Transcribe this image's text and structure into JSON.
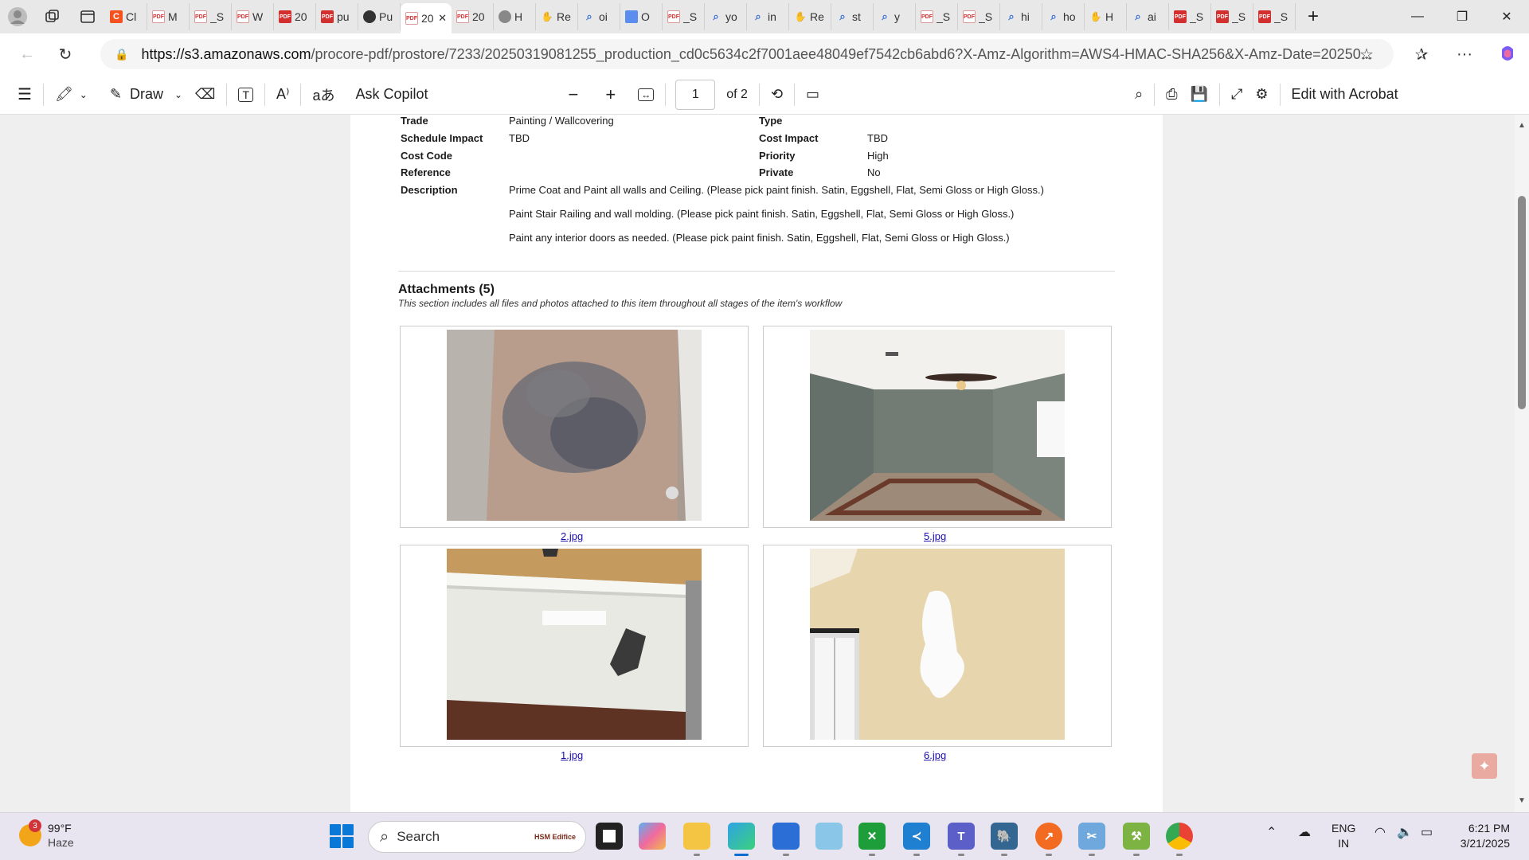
{
  "browser": {
    "tabs": [
      {
        "icon": "orange-c-favicon",
        "title": "Cl"
      },
      {
        "icon": "pdf-light-favicon",
        "title": "M"
      },
      {
        "icon": "pdf-light-favicon",
        "title": "_S"
      },
      {
        "icon": "pdf-light-favicon",
        "title": "W"
      },
      {
        "icon": "pdf-favicon",
        "title": "20"
      },
      {
        "icon": "pdf-favicon",
        "title": "pu"
      },
      {
        "icon": "black-circle-favicon",
        "title": "Pu"
      },
      {
        "icon": "pdf-light-favicon",
        "title": "20",
        "active": true
      },
      {
        "icon": "pdf-light-favicon",
        "title": "20"
      },
      {
        "icon": "gray-circle-favicon",
        "title": "H"
      },
      {
        "icon": "hand-favicon",
        "title": "Re"
      },
      {
        "icon": "search-favicon",
        "title": "oi"
      },
      {
        "icon": "doc-favicon",
        "title": "O"
      },
      {
        "icon": "pdf-light-favicon",
        "title": "_S"
      },
      {
        "icon": "search-favicon",
        "title": "yo"
      },
      {
        "icon": "search-favicon",
        "title": "in"
      },
      {
        "icon": "hand-favicon",
        "title": "Re"
      },
      {
        "icon": "search-favicon",
        "title": "st"
      },
      {
        "icon": "search-favicon",
        "title": "y"
      },
      {
        "icon": "pdf-light-favicon",
        "title": "_S"
      },
      {
        "icon": "pdf-light-favicon",
        "title": "_S"
      },
      {
        "icon": "search-favicon",
        "title": "hi"
      },
      {
        "icon": "search-favicon",
        "title": "ho"
      },
      {
        "icon": "hand-favicon",
        "title": "H"
      },
      {
        "icon": "search-favicon",
        "title": "ai"
      },
      {
        "icon": "pdf-favicon",
        "title": "_S"
      },
      {
        "icon": "pdf-favicon",
        "title": "_S"
      },
      {
        "icon": "pdf-favicon",
        "title": "_S"
      }
    ],
    "url_host": "https://s3.amazonaws.com",
    "url_path": "/procore-pdf/prostore/7233/20250319081255_production_cd0c5634c2f7001aee48049ef7542cb6abd6?X-Amz-Algorithm=AWS4-HMAC-SHA256&X-Amz-Date=20250..."
  },
  "pdf_toolbar": {
    "draw_label": "Draw",
    "ask_copilot_label": "Ask Copilot",
    "page_current": "1",
    "page_total": "of 2",
    "edit_acrobat_label": "Edit with Acrobat"
  },
  "document": {
    "fields_left": [
      {
        "label": "Trade",
        "value": "Painting / Wallcovering"
      },
      {
        "label": "Schedule Impact",
        "value": "TBD"
      },
      {
        "label": "Cost Code",
        "value": ""
      },
      {
        "label": "Reference",
        "value": ""
      },
      {
        "label": "Description",
        "value": "Prime Coat and Paint all walls and Ceiling. (Please pick paint finish. Satin, Eggshell, Flat, Semi Gloss or High Gloss.)"
      }
    ],
    "fields_right": [
      {
        "label": "Type",
        "value": ""
      },
      {
        "label": "Cost Impact",
        "value": "TBD"
      },
      {
        "label": "Priority",
        "value": "High"
      },
      {
        "label": "Private",
        "value": "No"
      }
    ],
    "description_extra": [
      "Paint Stair Railing and wall molding. (Please pick paint finish. Satin, Eggshell, Flat, Semi Gloss or High Gloss.)",
      "Paint any interior doors as needed. (Please pick paint finish. Satin, Eggshell, Flat, Semi Gloss or High Gloss.)"
    ],
    "attachments_title": "Attachments (5)",
    "attachments_subtitle": "This section includes all files and photos attached to this item throughout all stages of the item's workflow",
    "attachments": [
      {
        "name": "2.jpg",
        "photo": "damaged-wall-corner-photo"
      },
      {
        "name": "5.jpg",
        "photo": "empty-room-ceiling-fan-photo"
      },
      {
        "name": "1.jpg",
        "photo": "scuffed-wall-stair-photo"
      },
      {
        "name": "6.jpg",
        "photo": "patched-wall-photo"
      }
    ]
  },
  "taskbar": {
    "weather_badge": "3",
    "temperature": "99°F",
    "condition": "Haze",
    "search_placeholder": "Search",
    "search_promo": "HSM Edifice",
    "lang_line1": "ENG",
    "lang_line2": "IN",
    "time": "6:21 PM",
    "date": "3/21/2025"
  }
}
